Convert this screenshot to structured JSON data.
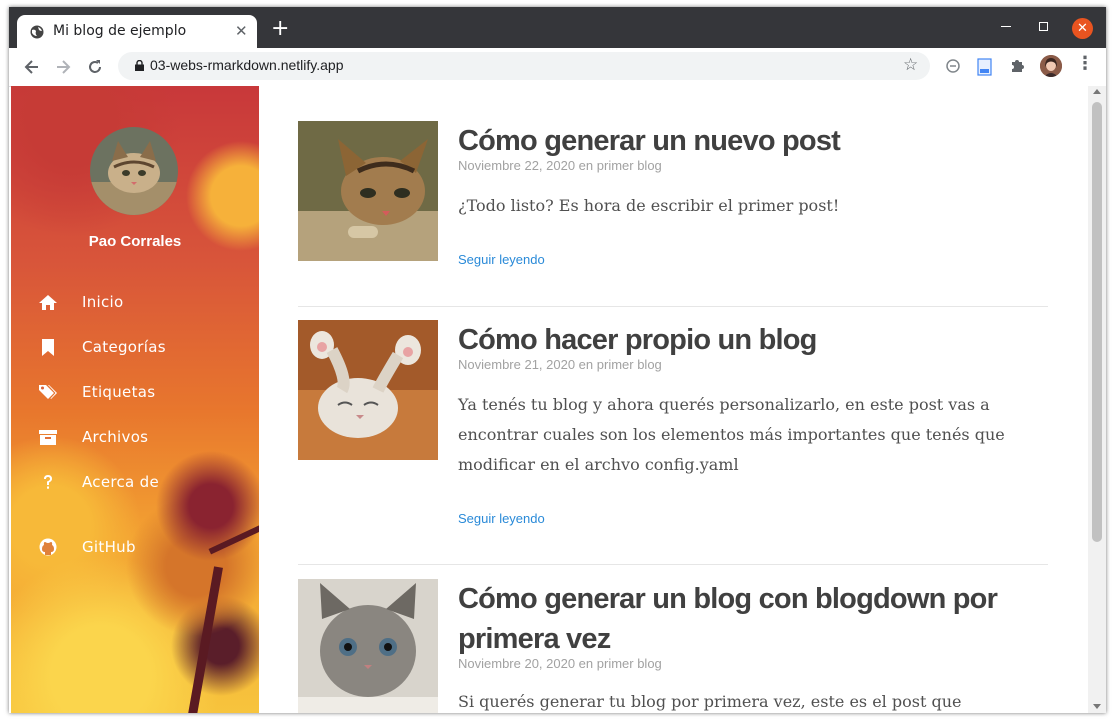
{
  "browser": {
    "tab_title": "Mi blog de ejemplo",
    "tab_close": "✕",
    "new_tab": "+",
    "url": "03-webs-rmarkdown.netlify.app",
    "window_close": "✕",
    "star": "☆",
    "menu": "⋮"
  },
  "sidebar": {
    "author": "Pao Corrales",
    "items": [
      {
        "label": "Inicio",
        "icon": "home-icon"
      },
      {
        "label": "Categorías",
        "icon": "bookmark-icon"
      },
      {
        "label": "Etiquetas",
        "icon": "tags-icon"
      },
      {
        "label": "Archivos",
        "icon": "archive-icon"
      },
      {
        "label": "Acerca de",
        "icon": "question-icon"
      },
      {
        "label": "GitHub",
        "icon": "github-icon"
      }
    ]
  },
  "posts": [
    {
      "title": "Cómo generar un nuevo post",
      "meta": "Noviembre 22, 2020 en primer blog",
      "summary": "¿Todo listo? Es hora de escribir el primer post!",
      "more": "Seguir leyendo"
    },
    {
      "title": "Cómo hacer propio un blog",
      "meta": "Noviembre 21, 2020 en primer blog",
      "summary": "Ya tenés tu blog y ahora querés personalizarlo, en este post vas a encontrar cuales son los elementos más importantes que tenés que modificar en el archvo config.yaml",
      "more": "Seguir leyendo"
    },
    {
      "title": "Cómo generar un blog con blogdown por primera vez",
      "meta": "Noviembre 20, 2020 en primer blog",
      "summary": "Si querés generar tu blog por primera vez, este es el post que necesitas!"
    }
  ]
}
